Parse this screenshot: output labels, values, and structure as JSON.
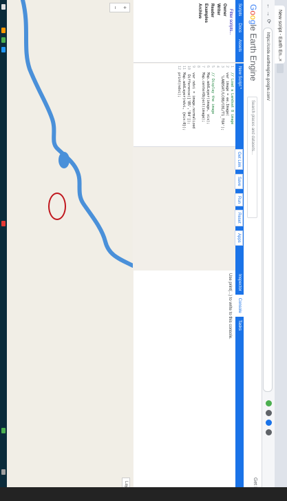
{
  "browser": {
    "tab_title": "New script - Earth En...",
    "tab_close": "×",
    "url": "https://code.earthengine.google.com/",
    "nav_back": "←",
    "nav_forward": "→",
    "nav_reload": "⟳"
  },
  "app": {
    "logo_parts": [
      "G",
      "o",
      "o",
      "g",
      "le Earth Engine"
    ],
    "search_placeholder": "Search places and datasets...",
    "header_right": "Get Link"
  },
  "left_panel": {
    "tabs": [
      "Scripts",
      "Docs",
      "Assets"
    ],
    "tree": [
      {
        "label": "Filter scripts...",
        "type": "item"
      },
      {
        "label": "Owner",
        "type": "folder"
      },
      {
        "label": "Writer",
        "type": "folder"
      },
      {
        "label": "Reader",
        "type": "folder"
      },
      {
        "label": "Examples",
        "type": "folder"
      },
      {
        "label": "Archive",
        "type": "folder"
      }
    ]
  },
  "editor": {
    "title": "New Script *",
    "lines": [
      {
        "n": "1",
        "code": "// Load a Landsat 8 image"
      },
      {
        "n": "2",
        "code": "var image = ee.Image("
      },
      {
        "n": "3",
        "code": "  'LANDSAT/LC08/C01/T1_TOA');"
      },
      {
        "n": "4",
        "code": ""
      },
      {
        "n": "5",
        "code": "// Display the image"
      },
      {
        "n": "6",
        "code": "Map.addLayer(image, vis);"
      },
      {
        "n": "7",
        "code": "Map.centerObject(image);"
      },
      {
        "n": "8",
        "code": ""
      },
      {
        "n": "9",
        "code": "var ndvi = image.normalized"
      },
      {
        "n": "10",
        "code": "  Difference(['B5','B4']);"
      },
      {
        "n": "11",
        "code": "Map.addLayer(ndvi, {min:0});"
      },
      {
        "n": "12",
        "code": "print(ndvi);"
      }
    ]
  },
  "editor_tools": {
    "get_link": "Get Link",
    "save": "Save",
    "run": "Run",
    "reset": "Reset",
    "apps": "Apps"
  },
  "right_panel": {
    "tabs": [
      "Inspector",
      "Console",
      "Tasks"
    ],
    "active_tab": "Console",
    "body_text": "Use print(...) to write to this console."
  },
  "map": {
    "zoom_in": "+",
    "zoom_out": "−",
    "layers_label": "Layers"
  },
  "colors": {
    "accent": "#1a73e8",
    "highlight_circle": "#c0161d",
    "river": "#4a90d9",
    "map_bg": "#f1eee6"
  }
}
